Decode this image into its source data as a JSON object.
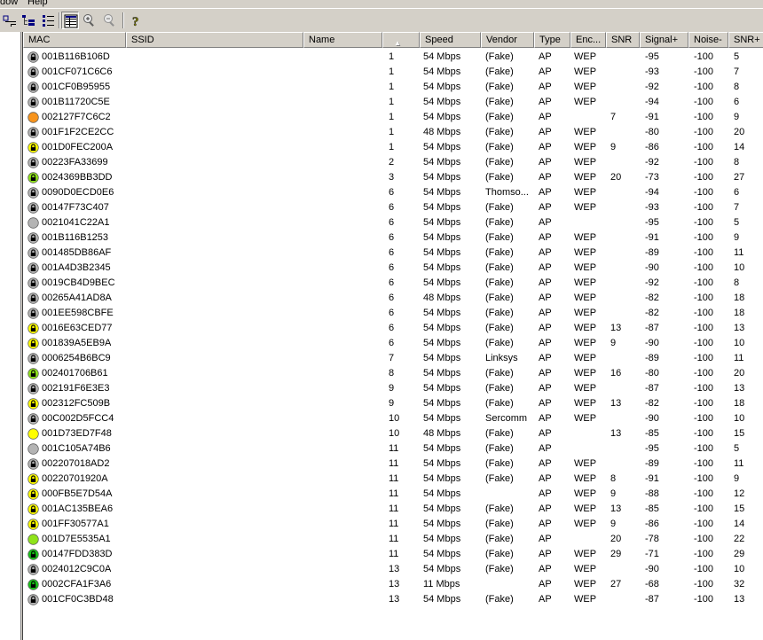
{
  "menu": [
    "dow",
    "Help"
  ],
  "toolbar": {
    "buttons": [
      {
        "name": "filter-icon",
        "pressed": false
      },
      {
        "name": "tree-view-icon",
        "pressed": false
      },
      {
        "name": "details-view-icon",
        "pressed": false
      },
      {
        "name": "list-view-icon",
        "pressed": true
      },
      {
        "name": "zoom-in-icon",
        "pressed": false
      },
      {
        "name": "zoom-out-icon",
        "pressed": false
      },
      {
        "name": "help-icon",
        "pressed": false
      }
    ]
  },
  "columns": [
    {
      "key": "mac",
      "label": "MAC"
    },
    {
      "key": "ssid",
      "label": "SSID"
    },
    {
      "key": "name",
      "label": "Name"
    },
    {
      "key": "channel",
      "label": "",
      "sorted": true
    },
    {
      "key": "speed",
      "label": "Speed"
    },
    {
      "key": "vendor",
      "label": "Vendor"
    },
    {
      "key": "type",
      "label": "Type"
    },
    {
      "key": "enc",
      "label": "Enc..."
    },
    {
      "key": "snr",
      "label": "SNR"
    },
    {
      "key": "signal",
      "label": "Signal+"
    },
    {
      "key": "noise",
      "label": "Noise-"
    },
    {
      "key": "snr_plus",
      "label": "SNR+"
    }
  ],
  "status_colors": {
    "gray": "#b4b4b4",
    "orange": "#f7941d",
    "yellow": "#ffff00",
    "lime": "#8fe31a",
    "green": "#18c418"
  },
  "rows": [
    {
      "mac": "001B116B106D",
      "ssid": "",
      "name": "",
      "channel": "1",
      "speed": "54 Mbps",
      "vendor": "(Fake)",
      "type": "AP",
      "enc": "WEP",
      "snr": "",
      "signal": "-95",
      "noise": "-100",
      "snr_plus": "5",
      "status": "gray",
      "lock": true
    },
    {
      "mac": "001CF071C6C6",
      "ssid": "",
      "name": "",
      "channel": "1",
      "speed": "54 Mbps",
      "vendor": "(Fake)",
      "type": "AP",
      "enc": "WEP",
      "snr": "",
      "signal": "-93",
      "noise": "-100",
      "snr_plus": "7",
      "status": "gray",
      "lock": true
    },
    {
      "mac": "001CF0B95955",
      "ssid": "",
      "name": "",
      "channel": "1",
      "speed": "54 Mbps",
      "vendor": "(Fake)",
      "type": "AP",
      "enc": "WEP",
      "snr": "",
      "signal": "-92",
      "noise": "-100",
      "snr_plus": "8",
      "status": "gray",
      "lock": true
    },
    {
      "mac": "001B11720C5E",
      "ssid": "",
      "name": "",
      "channel": "1",
      "speed": "54 Mbps",
      "vendor": "(Fake)",
      "type": "AP",
      "enc": "WEP",
      "snr": "",
      "signal": "-94",
      "noise": "-100",
      "snr_plus": "6",
      "status": "gray",
      "lock": true
    },
    {
      "mac": "002127F7C6C2",
      "ssid": "",
      "name": "",
      "channel": "1",
      "speed": "54 Mbps",
      "vendor": "(Fake)",
      "type": "AP",
      "enc": "",
      "snr": "7",
      "signal": "-91",
      "noise": "-100",
      "snr_plus": "9",
      "status": "orange",
      "lock": false
    },
    {
      "mac": "001F1F2CE2CC",
      "ssid": "",
      "name": "",
      "channel": "1",
      "speed": "48 Mbps",
      "vendor": "(Fake)",
      "type": "AP",
      "enc": "WEP",
      "snr": "",
      "signal": "-80",
      "noise": "-100",
      "snr_plus": "20",
      "status": "gray",
      "lock": true
    },
    {
      "mac": "001D0FEC200A",
      "ssid": "",
      "name": "",
      "channel": "1",
      "speed": "54 Mbps",
      "vendor": "(Fake)",
      "type": "AP",
      "enc": "WEP",
      "snr": "9",
      "signal": "-86",
      "noise": "-100",
      "snr_plus": "14",
      "status": "yellow",
      "lock": true
    },
    {
      "mac": "00223FA33699",
      "ssid": "",
      "name": "",
      "channel": "2",
      "speed": "54 Mbps",
      "vendor": "(Fake)",
      "type": "AP",
      "enc": "WEP",
      "snr": "",
      "signal": "-92",
      "noise": "-100",
      "snr_plus": "8",
      "status": "gray",
      "lock": true
    },
    {
      "mac": "0024369BB3DD",
      "ssid": "",
      "name": "",
      "channel": "3",
      "speed": "54 Mbps",
      "vendor": "(Fake)",
      "type": "AP",
      "enc": "WEP",
      "snr": "20",
      "signal": "-73",
      "noise": "-100",
      "snr_plus": "27",
      "status": "lime",
      "lock": true
    },
    {
      "mac": "0090D0ECD0E6",
      "ssid": "",
      "name": "",
      "channel": "6",
      "speed": "54 Mbps",
      "vendor": "Thomso...",
      "type": "AP",
      "enc": "WEP",
      "snr": "",
      "signal": "-94",
      "noise": "-100",
      "snr_plus": "6",
      "status": "gray",
      "lock": true
    },
    {
      "mac": "00147F73C407",
      "ssid": "",
      "name": "",
      "channel": "6",
      "speed": "54 Mbps",
      "vendor": "(Fake)",
      "type": "AP",
      "enc": "WEP",
      "snr": "",
      "signal": "-93",
      "noise": "-100",
      "snr_plus": "7",
      "status": "gray",
      "lock": true
    },
    {
      "mac": "0021041C22A1",
      "ssid": "",
      "name": "",
      "channel": "6",
      "speed": "54 Mbps",
      "vendor": "(Fake)",
      "type": "AP",
      "enc": "",
      "snr": "",
      "signal": "-95",
      "noise": "-100",
      "snr_plus": "5",
      "status": "gray",
      "lock": false
    },
    {
      "mac": "001B116B1253",
      "ssid": "",
      "name": "",
      "channel": "6",
      "speed": "54 Mbps",
      "vendor": "(Fake)",
      "type": "AP",
      "enc": "WEP",
      "snr": "",
      "signal": "-91",
      "noise": "-100",
      "snr_plus": "9",
      "status": "gray",
      "lock": true
    },
    {
      "mac": "001485DB86AF",
      "ssid": "",
      "name": "",
      "channel": "6",
      "speed": "54 Mbps",
      "vendor": "(Fake)",
      "type": "AP",
      "enc": "WEP",
      "snr": "",
      "signal": "-89",
      "noise": "-100",
      "snr_plus": "11",
      "status": "gray",
      "lock": true
    },
    {
      "mac": "001A4D3B2345",
      "ssid": "",
      "name": "",
      "channel": "6",
      "speed": "54 Mbps",
      "vendor": "(Fake)",
      "type": "AP",
      "enc": "WEP",
      "snr": "",
      "signal": "-90",
      "noise": "-100",
      "snr_plus": "10",
      "status": "gray",
      "lock": true
    },
    {
      "mac": "0019CB4D9BEC",
      "ssid": "",
      "name": "",
      "channel": "6",
      "speed": "54 Mbps",
      "vendor": "(Fake)",
      "type": "AP",
      "enc": "WEP",
      "snr": "",
      "signal": "-92",
      "noise": "-100",
      "snr_plus": "8",
      "status": "gray",
      "lock": true
    },
    {
      "mac": "00265A41AD8A",
      "ssid": "",
      "name": "",
      "channel": "6",
      "speed": "48 Mbps",
      "vendor": "(Fake)",
      "type": "AP",
      "enc": "WEP",
      "snr": "",
      "signal": "-82",
      "noise": "-100",
      "snr_plus": "18",
      "status": "gray",
      "lock": true
    },
    {
      "mac": "001EE598CBFE",
      "ssid": "",
      "name": "",
      "channel": "6",
      "speed": "54 Mbps",
      "vendor": "(Fake)",
      "type": "AP",
      "enc": "WEP",
      "snr": "",
      "signal": "-82",
      "noise": "-100",
      "snr_plus": "18",
      "status": "gray",
      "lock": true
    },
    {
      "mac": "0016E63CED77",
      "ssid": "",
      "name": "",
      "channel": "6",
      "speed": "54 Mbps",
      "vendor": "(Fake)",
      "type": "AP",
      "enc": "WEP",
      "snr": "13",
      "signal": "-87",
      "noise": "-100",
      "snr_plus": "13",
      "status": "yellow",
      "lock": true
    },
    {
      "mac": "001839A5EB9A",
      "ssid": "",
      "name": "",
      "channel": "6",
      "speed": "54 Mbps",
      "vendor": "(Fake)",
      "type": "AP",
      "enc": "WEP",
      "snr": "9",
      "signal": "-90",
      "noise": "-100",
      "snr_plus": "10",
      "status": "yellow",
      "lock": true
    },
    {
      "mac": "0006254B6BC9",
      "ssid": "",
      "name": "",
      "channel": "7",
      "speed": "54 Mbps",
      "vendor": "Linksys",
      "type": "AP",
      "enc": "WEP",
      "snr": "",
      "signal": "-89",
      "noise": "-100",
      "snr_plus": "11",
      "status": "gray",
      "lock": true
    },
    {
      "mac": "002401706B61",
      "ssid": "",
      "name": "",
      "channel": "8",
      "speed": "54 Mbps",
      "vendor": "(Fake)",
      "type": "AP",
      "enc": "WEP",
      "snr": "16",
      "signal": "-80",
      "noise": "-100",
      "snr_plus": "20",
      "status": "lime",
      "lock": true
    },
    {
      "mac": "002191F6E3E3",
      "ssid": "",
      "name": "",
      "channel": "9",
      "speed": "54 Mbps",
      "vendor": "(Fake)",
      "type": "AP",
      "enc": "WEP",
      "snr": "",
      "signal": "-87",
      "noise": "-100",
      "snr_plus": "13",
      "status": "gray",
      "lock": true
    },
    {
      "mac": "002312FC509B",
      "ssid": "",
      "name": "",
      "channel": "9",
      "speed": "54 Mbps",
      "vendor": "(Fake)",
      "type": "AP",
      "enc": "WEP",
      "snr": "13",
      "signal": "-82",
      "noise": "-100",
      "snr_plus": "18",
      "status": "yellow",
      "lock": true
    },
    {
      "mac": "00C002D5FCC4",
      "ssid": "",
      "name": "",
      "channel": "10",
      "speed": "54 Mbps",
      "vendor": "Sercomm",
      "type": "AP",
      "enc": "WEP",
      "snr": "",
      "signal": "-90",
      "noise": "-100",
      "snr_plus": "10",
      "status": "gray",
      "lock": true
    },
    {
      "mac": "001D73ED7F48",
      "ssid": "",
      "name": "",
      "channel": "10",
      "speed": "48 Mbps",
      "vendor": "(Fake)",
      "type": "AP",
      "enc": "",
      "snr": "13",
      "signal": "-85",
      "noise": "-100",
      "snr_plus": "15",
      "status": "yellow",
      "lock": false
    },
    {
      "mac": "001C105A74B6",
      "ssid": "",
      "name": "",
      "channel": "11",
      "speed": "54 Mbps",
      "vendor": "(Fake)",
      "type": "AP",
      "enc": "",
      "snr": "",
      "signal": "-95",
      "noise": "-100",
      "snr_plus": "5",
      "status": "gray",
      "lock": false
    },
    {
      "mac": "002207018AD2",
      "ssid": "",
      "name": "",
      "channel": "11",
      "speed": "54 Mbps",
      "vendor": "(Fake)",
      "type": "AP",
      "enc": "WEP",
      "snr": "",
      "signal": "-89",
      "noise": "-100",
      "snr_plus": "11",
      "status": "gray",
      "lock": true
    },
    {
      "mac": "00220701920A",
      "ssid": "",
      "name": "",
      "channel": "11",
      "speed": "54 Mbps",
      "vendor": "(Fake)",
      "type": "AP",
      "enc": "WEP",
      "snr": "8",
      "signal": "-91",
      "noise": "-100",
      "snr_plus": "9",
      "status": "yellow",
      "lock": true
    },
    {
      "mac": "000FB5E7D54A",
      "ssid": "",
      "name": "",
      "channel": "11",
      "speed": "54 Mbps",
      "vendor": "",
      "type": "AP",
      "enc": "WEP",
      "snr": "9",
      "signal": "-88",
      "noise": "-100",
      "snr_plus": "12",
      "status": "yellow",
      "lock": true
    },
    {
      "mac": "001AC135BEA6",
      "ssid": "",
      "name": "",
      "channel": "11",
      "speed": "54 Mbps",
      "vendor": "(Fake)",
      "type": "AP",
      "enc": "WEP",
      "snr": "13",
      "signal": "-85",
      "noise": "-100",
      "snr_plus": "15",
      "status": "yellow",
      "lock": true
    },
    {
      "mac": "001FF30577A1",
      "ssid": "",
      "name": "",
      "channel": "11",
      "speed": "54 Mbps",
      "vendor": "(Fake)",
      "type": "AP",
      "enc": "WEP",
      "snr": "9",
      "signal": "-86",
      "noise": "-100",
      "snr_plus": "14",
      "status": "yellow",
      "lock": true
    },
    {
      "mac": "001D7E5535A1",
      "ssid": "",
      "name": "",
      "channel": "11",
      "speed": "54 Mbps",
      "vendor": "(Fake)",
      "type": "AP",
      "enc": "",
      "snr": "20",
      "signal": "-78",
      "noise": "-100",
      "snr_plus": "22",
      "status": "lime",
      "lock": false
    },
    {
      "mac": "00147FDD383D",
      "ssid": "",
      "name": "",
      "channel": "11",
      "speed": "54 Mbps",
      "vendor": "(Fake)",
      "type": "AP",
      "enc": "WEP",
      "snr": "29",
      "signal": "-71",
      "noise": "-100",
      "snr_plus": "29",
      "status": "green",
      "lock": true
    },
    {
      "mac": "0024012C9C0A",
      "ssid": "",
      "name": "",
      "channel": "13",
      "speed": "54 Mbps",
      "vendor": "(Fake)",
      "type": "AP",
      "enc": "WEP",
      "snr": "",
      "signal": "-90",
      "noise": "-100",
      "snr_plus": "10",
      "status": "gray",
      "lock": true
    },
    {
      "mac": "0002CFA1F3A6",
      "ssid": "",
      "name": "",
      "channel": "13",
      "speed": "11 Mbps",
      "vendor": "",
      "type": "AP",
      "enc": "WEP",
      "snr": "27",
      "signal": "-68",
      "noise": "-100",
      "snr_plus": "32",
      "status": "green",
      "lock": true
    },
    {
      "mac": "001CF0C3BD48",
      "ssid": "",
      "name": "",
      "channel": "13",
      "speed": "54 Mbps",
      "vendor": "(Fake)",
      "type": "AP",
      "enc": "WEP",
      "snr": "",
      "signal": "-87",
      "noise": "-100",
      "snr_plus": "13",
      "status": "gray",
      "lock": true
    }
  ]
}
